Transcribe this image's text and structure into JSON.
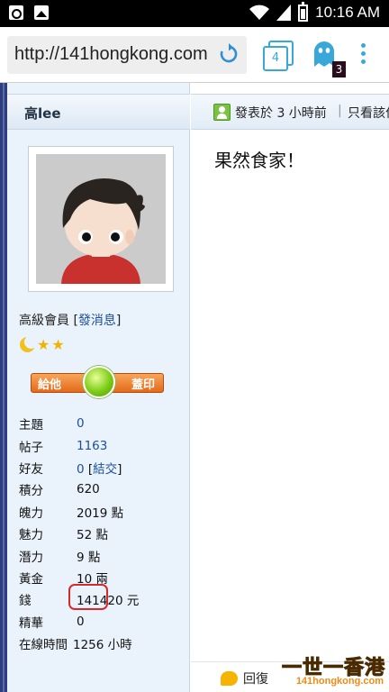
{
  "status_bar": {
    "time": "10:16 AM"
  },
  "browser": {
    "url": "http://141hongkong.com",
    "tab_count": "4",
    "ghost_badge": "3"
  },
  "sidebar": {
    "username": "高lee",
    "rank": "高級會員",
    "send_message": "發消息",
    "stamp_left": "給他",
    "stamp_right": "蓋印",
    "stats": [
      {
        "key": "主題",
        "value": "0",
        "link": true
      },
      {
        "key": "帖子",
        "value": "1163",
        "link": true
      },
      {
        "key": "好友",
        "value": "0",
        "extra": "結交",
        "link": true
      },
      {
        "key": "積分",
        "value": "620"
      },
      {
        "key": "魄力",
        "value": "2019 點"
      },
      {
        "key": "魅力",
        "value": "52 點"
      },
      {
        "key": "潛力",
        "value": "9 點"
      },
      {
        "key": "黃金",
        "value": "10 兩"
      },
      {
        "key": "錢",
        "value": "141420 元"
      },
      {
        "key": "精華",
        "value": "0"
      },
      {
        "key": "在線時間",
        "value": "1256 小時"
      }
    ]
  },
  "post": {
    "posted": "發表於 3 小時前",
    "separator": "|",
    "author_only": "只看該作者",
    "body": "果然食家！",
    "reply": "回復"
  },
  "watermark": {
    "line1": "一世一香港",
    "line2": "141hongkong.com"
  }
}
